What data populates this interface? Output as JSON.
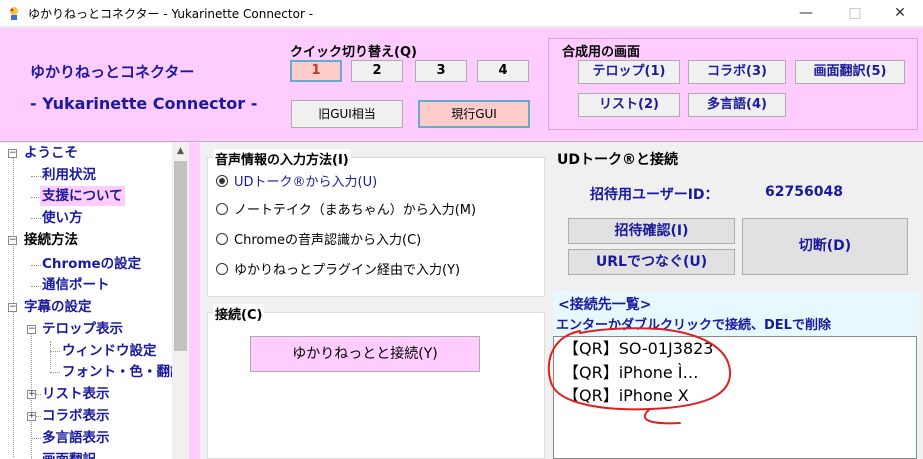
{
  "window": {
    "title": "ゆかりねっとコネクター - Yukarinette Connector -"
  },
  "header": {
    "brand_jp": "ゆかりねっとコネクター",
    "brand_en": "- Yukarinette Connector -",
    "quick_switch_label": "クイック切り替え(Q)",
    "quick_buttons": [
      "1",
      "2",
      "3",
      "4"
    ],
    "quick_active_index": 0,
    "old_gui_label": "旧GUI相当",
    "current_gui_label": "現行GUI",
    "compose_label": "合成用の画面",
    "compose_buttons": [
      "テロップ(1)",
      "コラボ(3)",
      "画面翻訳(5)",
      "リスト(2)",
      "多言語(4)"
    ]
  },
  "tree": {
    "items": [
      "ようこそ",
      "利用状況",
      "支援について",
      "使い方",
      "接続方法",
      "Chromeの設定",
      "通信ポート",
      "字幕の設定",
      "テロップ表示",
      "ウィンドウ設定",
      "フォント・色・翻訳",
      "リスト表示",
      "コラボ表示",
      "多言語表示",
      "画面翻訳"
    ],
    "selected": "支援について"
  },
  "input_method": {
    "title": "音声情報の入力方法(I)",
    "options": [
      "UDトーク®から入力(U)",
      "ノートテイク（まあちゃん）から入力(M)",
      "Chromeの音声認識から入力(C)",
      "ゆかりねっとプラグイン経由で入力(Y)"
    ],
    "selected_index": 0
  },
  "connect": {
    "title": "接続(C)",
    "button_label": "ゆかりねっとと接続(Y)"
  },
  "udtalk": {
    "title": "UDトーク®と接続",
    "invite_label": "招待用ユーザーID：",
    "invite_id": "62756048",
    "confirm_button": "招待確認(I)",
    "url_button": "URLでつなぐ(U)",
    "disconnect_button": "切断(D)",
    "list_heading": "<接続先一覧>",
    "list_hint": "エンターかダブルクリックで接続、DELで削除",
    "connections": [
      "【QR】SO-01J3823",
      "【QR】iPhone Ì…",
      "【QR】iPhone X"
    ]
  },
  "colors": {
    "pink": "#ffccff",
    "navy": "#1a1a9e",
    "active_button": "#ffcccc",
    "annotation_red": "#e02020"
  }
}
